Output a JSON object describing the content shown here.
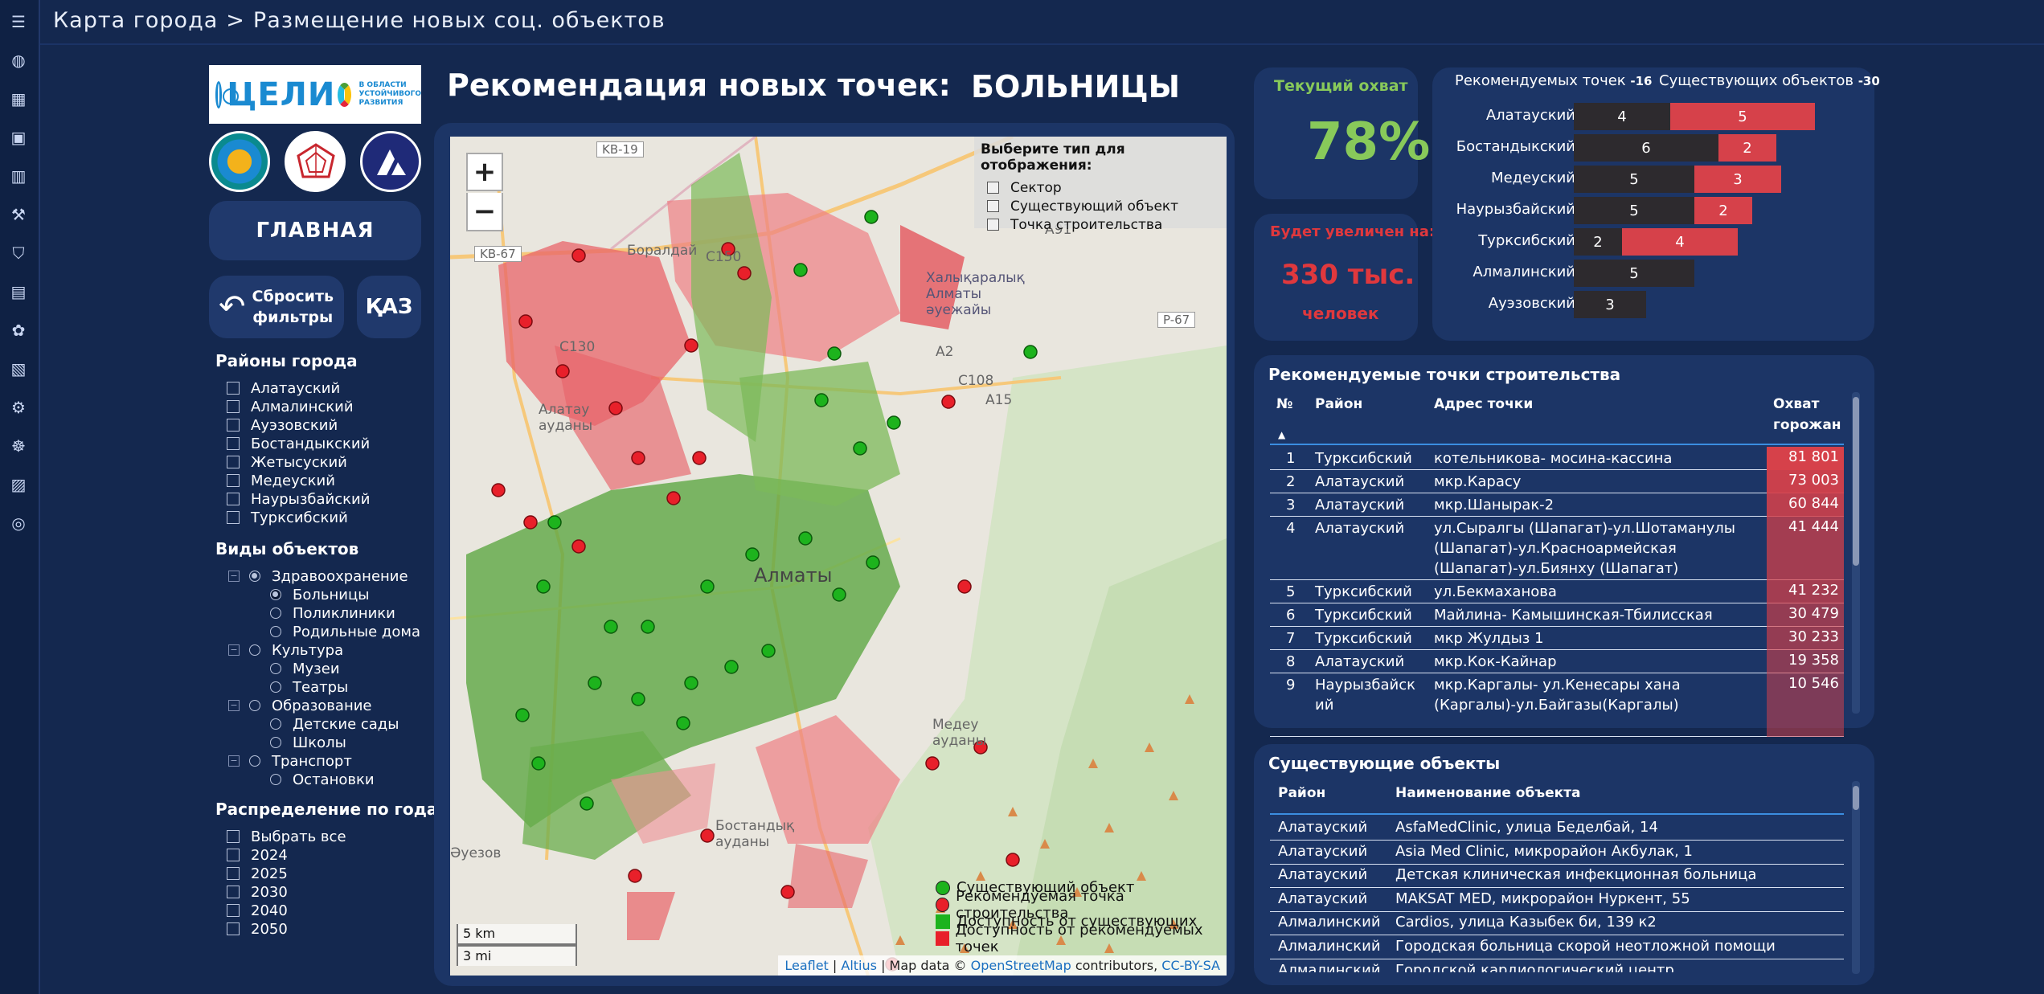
{
  "breadcrumb": {
    "root": "Карта города",
    "sep": ">",
    "page": "Размещение новых соц. объектов"
  },
  "logo": {
    "text_pre": "ЦЕЛИ",
    "text_post": "",
    "subtitle": "В ОБЛАСТИ УСТОЙЧИВОГО РАЗВИТИЯ"
  },
  "nav": {
    "main_label": "ГЛАВНАЯ",
    "reset_label_1": "Сбросить",
    "reset_label_2": "фильтры",
    "lang_label": "ҚАЗ"
  },
  "filters": {
    "districts_title": "Районы города",
    "districts": [
      "Алатауский",
      "Алмалинский",
      "Ауэзовский",
      "Бостандыкский",
      "Жетысуский",
      "Медеуский",
      "Наурызбайский",
      "Турксибский"
    ],
    "types_title": "Виды объектов",
    "types": [
      {
        "label": "Здравоохранение",
        "children": [
          "Больницы",
          "Поликлиники",
          "Родильные дома"
        ]
      },
      {
        "label": "Культура",
        "children": [
          "Музеи",
          "Театры"
        ]
      },
      {
        "label": "Образование",
        "children": [
          "Детские сады",
          "Школы"
        ]
      },
      {
        "label": "Транспорт",
        "children": [
          "Остановки"
        ]
      }
    ],
    "years_title": "Распределение по годам",
    "years": [
      "Выбрать все",
      "2024",
      "2025",
      "2030",
      "2040",
      "2050"
    ]
  },
  "header": {
    "title": "Рекомендация новых точек:",
    "category": "БОЛЬНИЦЫ"
  },
  "map": {
    "zoom_in": "+",
    "zoom_out": "−",
    "select_title": "Выберите тип для отображения:",
    "select_options": [
      "Сектор",
      "Существующий объект",
      "Точка строительства"
    ],
    "legend": [
      "Существующий объект",
      "Рекомендуемая точка строительства",
      "Доступность от существующих",
      "Доступность от рекомендуемых точек"
    ],
    "legend_colors": [
      "#1db31d",
      "#e8202a",
      "#1db31d",
      "#e8202a"
    ],
    "scale_km": "5 km",
    "scale_mi": "3 mi",
    "attr": {
      "leaflet": "Leaflet",
      "sep": " | ",
      "altius": "Altius",
      "mapdata": " | Map data © ",
      "osm": "OpenStreetMap",
      "contrib": " contributors, ",
      "license": "CC-BY-SA"
    },
    "labels": [
      "Алматы",
      "Боралдай",
      "Алатау ауданы",
      "Медеу ауданы",
      "Бостандық ауданы",
      "Әуезов",
      "KB-19",
      "KB-67",
      "P-67",
      "A2",
      "C108",
      "C130",
      "C150",
      "A15",
      "A91",
      "Халықаралық Алматы әуежайы"
    ]
  },
  "coverage": {
    "label": "Текущий охват",
    "value": "78%"
  },
  "increase": {
    "label": "Будет увеличен на:",
    "value": "330 тыс.",
    "unit": "человек"
  },
  "bars": {
    "rec_label": "Рекомендуемых точек",
    "rec_total": "-16",
    "ex_label": "Существующих объектов",
    "ex_total": "-30",
    "colors": {
      "existing": "#2d2a2e",
      "recommended": "#d6414a"
    },
    "rows": [
      {
        "district": "Алатауский",
        "existing": 4,
        "recommended": 5
      },
      {
        "district": "Бостандыкский",
        "existing": 6,
        "recommended": 2
      },
      {
        "district": "Медеуский",
        "existing": 5,
        "recommended": 3
      },
      {
        "district": "Наурызбайский",
        "existing": 5,
        "recommended": 2
      },
      {
        "district": "Турксибский",
        "existing": 2,
        "recommended": 4
      },
      {
        "district": "Алмалинский",
        "existing": 5,
        "recommended": 0
      },
      {
        "district": "Ауэзовский",
        "existing": 3,
        "recommended": 0
      }
    ]
  },
  "recommended": {
    "title": "Рекомендуемые точки строительства",
    "headers": {
      "num": "№",
      "district": "Район",
      "address": "Адрес точки",
      "coverage_1": "Охват",
      "coverage_2": "горожан"
    },
    "rows": [
      {
        "n": "1",
        "district": "Турксибский",
        "address": "котельникова- мосина-кассина",
        "coverage": "81 801"
      },
      {
        "n": "2",
        "district": "Алатауский",
        "address": "мкр.Карасу",
        "coverage": "73 003"
      },
      {
        "n": "3",
        "district": "Алатауский",
        "address": "мкр.Шанырак-2",
        "coverage": "60 844"
      },
      {
        "n": "4",
        "district": "Алатауский",
        "address": "ул.Сыралгы (Шапагат)-ул.Шотаманулы (Шапагат)-ул.Красноармейская (Шапагат)-ул.Биянху (Шапагат)",
        "coverage": "41 444"
      },
      {
        "n": "5",
        "district": "Турксибский",
        "address": "ул.Бекмаханова",
        "coverage": "41 232"
      },
      {
        "n": "6",
        "district": "Турксибский",
        "address": "Майлина- Камышинская-Тбилисская",
        "coverage": "30 479"
      },
      {
        "n": "7",
        "district": "Турксибский",
        "address": "мкр Жулдыз 1",
        "coverage": "30 233"
      },
      {
        "n": "8",
        "district": "Алатауский",
        "address": "мкр.Кок-Кайнар",
        "coverage": "19 358"
      },
      {
        "n": "9",
        "district": "Наурызбайский",
        "address": "мкр.Каргалы- ул.Кенесары хана (Каргалы)-ул.Байгазы(Каргалы)",
        "coverage": "10 546"
      }
    ]
  },
  "existing": {
    "title": "Существующие объекты",
    "headers": {
      "district": "Район",
      "name": "Наименование объекта"
    },
    "rows": [
      {
        "district": "Алатауский",
        "name": "AsfaMedClinic, улица Беделбай, 14"
      },
      {
        "district": "Алатауский",
        "name": "Asia Med Clinic, микрорайон Акбулак, 1"
      },
      {
        "district": "Алатауский",
        "name": "Детская клиническая инфекционная больница"
      },
      {
        "district": "Алатауский",
        "name": "MAKSAT MED, микрорайон Нуркент, 55"
      },
      {
        "district": "Алмалинский",
        "name": "Cardios, улица Казыбек би, 139 к2"
      },
      {
        "district": "Алмалинский",
        "name": "Городская больница скорой неотложной помощи"
      },
      {
        "district": "Алмалинский",
        "name": "Городской кардиологический центр"
      }
    ]
  }
}
